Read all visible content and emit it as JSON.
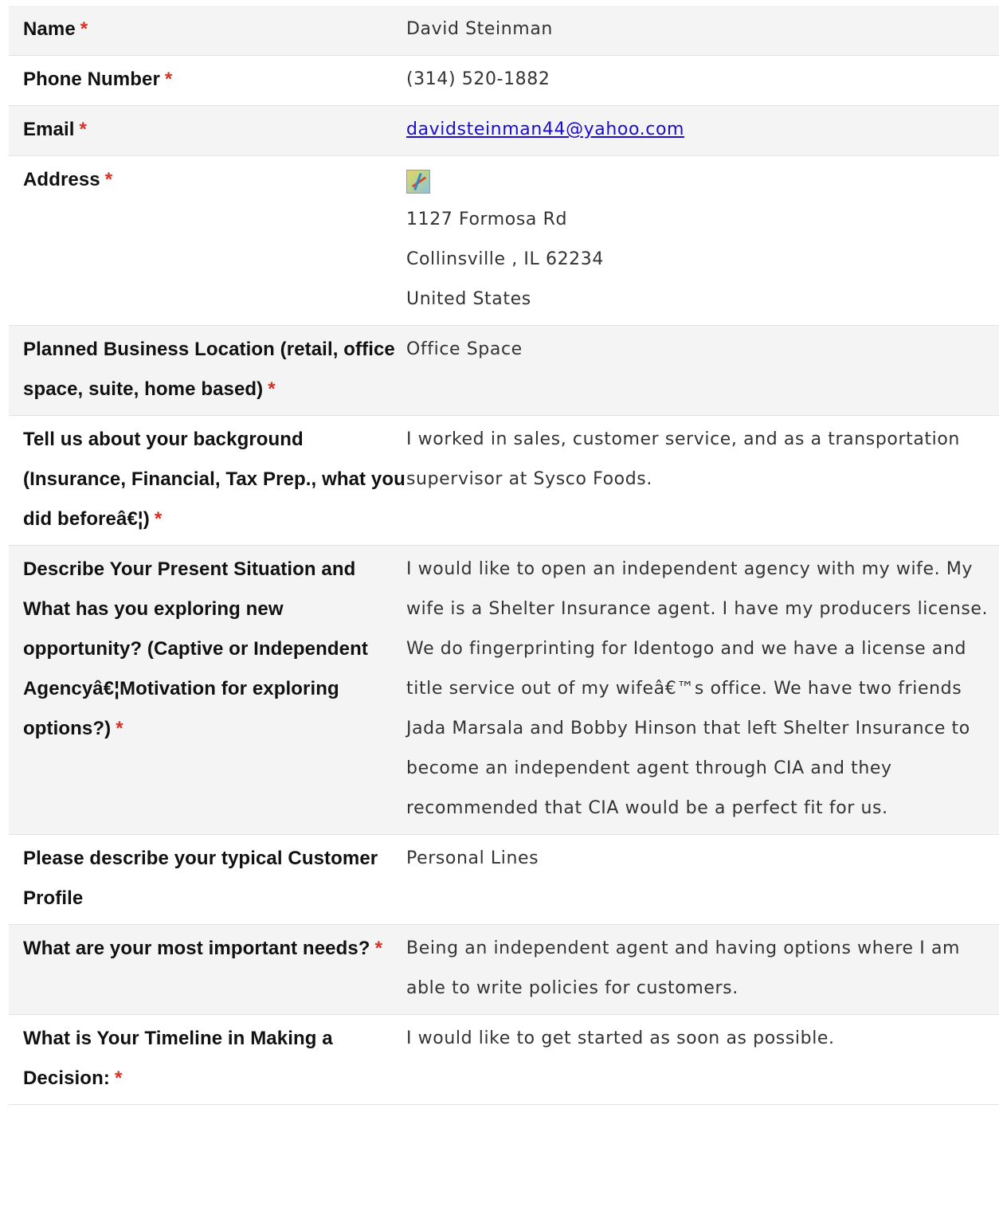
{
  "required_marker": "*",
  "rows": [
    {
      "label": "Name",
      "value": "David Steinman"
    },
    {
      "label": "Phone Number",
      "value": "(314) 520-1882"
    },
    {
      "label": "Email",
      "value": "davidsteinman44@yahoo.com"
    },
    {
      "label": "Address",
      "icon": "map-icon",
      "lines": [
        "1127 Formosa Rd",
        "Collinsville , IL 62234",
        "United States"
      ]
    },
    {
      "label": "Planned Business Location (retail, office space, suite, home based)",
      "value": "Office Space"
    },
    {
      "label": "Tell us about your background (Insurance, Financial, Tax Prep., what you did beforeâ€¦)",
      "value": "I worked in sales, customer service, and as a transportation supervisor at Sysco Foods."
    },
    {
      "label": "Describe Your Present Situation and What has you exploring new opportunity? (Captive or Independent Agencyâ€¦Motivation for exploring options?)",
      "value": "I would like to open an independent agency with my wife. My wife is a Shelter Insurance agent. I have my producers license. We do fingerprinting for Identogo and we have a license and title service out of my wifeâ€™s office. We have two friends Jada Marsala and Bobby Hinson that left Shelter Insurance to become an independent agent through CIA and they recommended that CIA would be a perfect fit for us."
    },
    {
      "label": "Please describe your typical Customer Profile",
      "value": "Personal Lines"
    },
    {
      "label": "What are your most important needs?",
      "value": "Being an independent agent and having options where I am able to write policies for customers."
    },
    {
      "label": "What is Your Timeline in Making a Decision:",
      "value": "I would like to get started as soon as possible."
    }
  ]
}
